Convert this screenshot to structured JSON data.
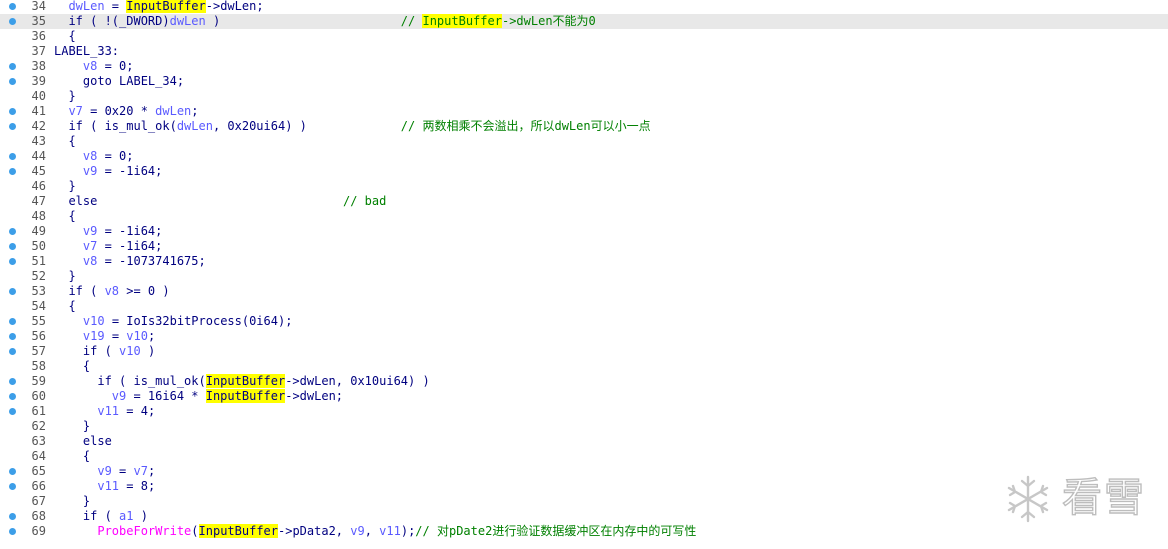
{
  "editor": {
    "lines": [
      {
        "num": "34",
        "bp": true,
        "tokens": [
          {
            "t": "  "
          },
          {
            "t": "dwLen",
            "c": "var"
          },
          {
            "t": " = "
          },
          {
            "t": "InputBuffer",
            "c": "hl"
          },
          {
            "t": "->dwLen;"
          }
        ]
      },
      {
        "num": "35",
        "bp": true,
        "current": true,
        "tokens": [
          {
            "t": "  if ( !(_DWORD)"
          },
          {
            "t": "dwLen",
            "c": "var"
          },
          {
            "t": " )                         "
          },
          {
            "t": "// ",
            "c": "cmt"
          },
          {
            "t": "InputBuffer",
            "c": "cmthl"
          },
          {
            "t": "->dwLen不能为0",
            "c": "cmt"
          }
        ]
      },
      {
        "num": "36",
        "bp": false,
        "tokens": [
          {
            "t": "  {"
          }
        ]
      },
      {
        "num": "37",
        "bp": false,
        "tokens": [
          {
            "t": "LABEL_33:"
          }
        ]
      },
      {
        "num": "38",
        "bp": true,
        "tokens": [
          {
            "t": "    "
          },
          {
            "t": "v8",
            "c": "var"
          },
          {
            "t": " = 0;"
          }
        ]
      },
      {
        "num": "39",
        "bp": true,
        "tokens": [
          {
            "t": "    goto LABEL_34;"
          }
        ]
      },
      {
        "num": "40",
        "bp": false,
        "tokens": [
          {
            "t": "  }"
          }
        ]
      },
      {
        "num": "41",
        "bp": true,
        "tokens": [
          {
            "t": "  "
          },
          {
            "t": "v7",
            "c": "var"
          },
          {
            "t": " = 0x20 * "
          },
          {
            "t": "dwLen",
            "c": "var"
          },
          {
            "t": ";"
          }
        ]
      },
      {
        "num": "42",
        "bp": true,
        "tokens": [
          {
            "t": "  if ( is_mul_ok("
          },
          {
            "t": "dwLen",
            "c": "var"
          },
          {
            "t": ", 0x20ui64) )             "
          },
          {
            "t": "// 两数相乘不会溢出，所以dwLen可以小一点",
            "c": "cmt"
          }
        ]
      },
      {
        "num": "43",
        "bp": false,
        "tokens": [
          {
            "t": "  {"
          }
        ]
      },
      {
        "num": "44",
        "bp": true,
        "tokens": [
          {
            "t": "    "
          },
          {
            "t": "v8",
            "c": "var"
          },
          {
            "t": " = 0;"
          }
        ]
      },
      {
        "num": "45",
        "bp": true,
        "tokens": [
          {
            "t": "    "
          },
          {
            "t": "v9",
            "c": "var"
          },
          {
            "t": " = -1i64;"
          }
        ]
      },
      {
        "num": "46",
        "bp": false,
        "tokens": [
          {
            "t": "  }"
          }
        ]
      },
      {
        "num": "47",
        "bp": false,
        "tokens": [
          {
            "t": "  else                                  "
          },
          {
            "t": "// bad",
            "c": "cmt"
          }
        ]
      },
      {
        "num": "48",
        "bp": false,
        "tokens": [
          {
            "t": "  {"
          }
        ]
      },
      {
        "num": "49",
        "bp": true,
        "tokens": [
          {
            "t": "    "
          },
          {
            "t": "v9",
            "c": "var"
          },
          {
            "t": " = -1i64;"
          }
        ]
      },
      {
        "num": "50",
        "bp": true,
        "tokens": [
          {
            "t": "    "
          },
          {
            "t": "v7",
            "c": "var"
          },
          {
            "t": " = -1i64;"
          }
        ]
      },
      {
        "num": "51",
        "bp": true,
        "tokens": [
          {
            "t": "    "
          },
          {
            "t": "v8",
            "c": "var"
          },
          {
            "t": " = -1073741675;"
          }
        ]
      },
      {
        "num": "52",
        "bp": false,
        "tokens": [
          {
            "t": "  }"
          }
        ]
      },
      {
        "num": "53",
        "bp": true,
        "tokens": [
          {
            "t": "  if ( "
          },
          {
            "t": "v8",
            "c": "var"
          },
          {
            "t": " >= 0 )"
          }
        ]
      },
      {
        "num": "54",
        "bp": false,
        "tokens": [
          {
            "t": "  {"
          }
        ]
      },
      {
        "num": "55",
        "bp": true,
        "tokens": [
          {
            "t": "    "
          },
          {
            "t": "v10",
            "c": "var"
          },
          {
            "t": " = IoIs32bitProcess(0i64);"
          }
        ]
      },
      {
        "num": "56",
        "bp": true,
        "tokens": [
          {
            "t": "    "
          },
          {
            "t": "v19",
            "c": "var"
          },
          {
            "t": " = "
          },
          {
            "t": "v10",
            "c": "var"
          },
          {
            "t": ";"
          }
        ]
      },
      {
        "num": "57",
        "bp": true,
        "tokens": [
          {
            "t": "    if ( "
          },
          {
            "t": "v10",
            "c": "var"
          },
          {
            "t": " )"
          }
        ]
      },
      {
        "num": "58",
        "bp": false,
        "tokens": [
          {
            "t": "    {"
          }
        ]
      },
      {
        "num": "59",
        "bp": true,
        "tokens": [
          {
            "t": "      if ( is_mul_ok("
          },
          {
            "t": "InputBuffer",
            "c": "hl"
          },
          {
            "t": "->dwLen, 0x10ui64) )"
          }
        ]
      },
      {
        "num": "60",
        "bp": true,
        "tokens": [
          {
            "t": "        "
          },
          {
            "t": "v9",
            "c": "var"
          },
          {
            "t": " = 16i64 * "
          },
          {
            "t": "InputBuffer",
            "c": "hl"
          },
          {
            "t": "->dwLen;"
          }
        ]
      },
      {
        "num": "61",
        "bp": true,
        "tokens": [
          {
            "t": "      "
          },
          {
            "t": "v11",
            "c": "var"
          },
          {
            "t": " = 4;"
          }
        ]
      },
      {
        "num": "62",
        "bp": false,
        "tokens": [
          {
            "t": "    }"
          }
        ]
      },
      {
        "num": "63",
        "bp": false,
        "tokens": [
          {
            "t": "    else"
          }
        ]
      },
      {
        "num": "64",
        "bp": false,
        "tokens": [
          {
            "t": "    {"
          }
        ]
      },
      {
        "num": "65",
        "bp": true,
        "tokens": [
          {
            "t": "      "
          },
          {
            "t": "v9",
            "c": "var"
          },
          {
            "t": " = "
          },
          {
            "t": "v7",
            "c": "var"
          },
          {
            "t": ";"
          }
        ]
      },
      {
        "num": "66",
        "bp": true,
        "tokens": [
          {
            "t": "      "
          },
          {
            "t": "v11",
            "c": "var"
          },
          {
            "t": " = 8;"
          }
        ]
      },
      {
        "num": "67",
        "bp": false,
        "tokens": [
          {
            "t": "    }"
          }
        ]
      },
      {
        "num": "68",
        "bp": true,
        "tokens": [
          {
            "t": "    if ( "
          },
          {
            "t": "a1",
            "c": "var"
          },
          {
            "t": " )"
          }
        ]
      },
      {
        "num": "69",
        "bp": true,
        "tokens": [
          {
            "t": "      "
          },
          {
            "t": "ProbeForWrite",
            "c": "func"
          },
          {
            "t": "("
          },
          {
            "t": "InputBuffer",
            "c": "hl"
          },
          {
            "t": "->pData2, "
          },
          {
            "t": "v9",
            "c": "var"
          },
          {
            "t": ", "
          },
          {
            "t": "v11",
            "c": "var"
          },
          {
            "t": ");"
          },
          {
            "t": "// 对pDate2进行验证数据缓冲区在内存中的可写性",
            "c": "cmt"
          }
        ]
      }
    ]
  },
  "watermark": {
    "text": "看雪",
    "icon": "snowflake-icon"
  }
}
